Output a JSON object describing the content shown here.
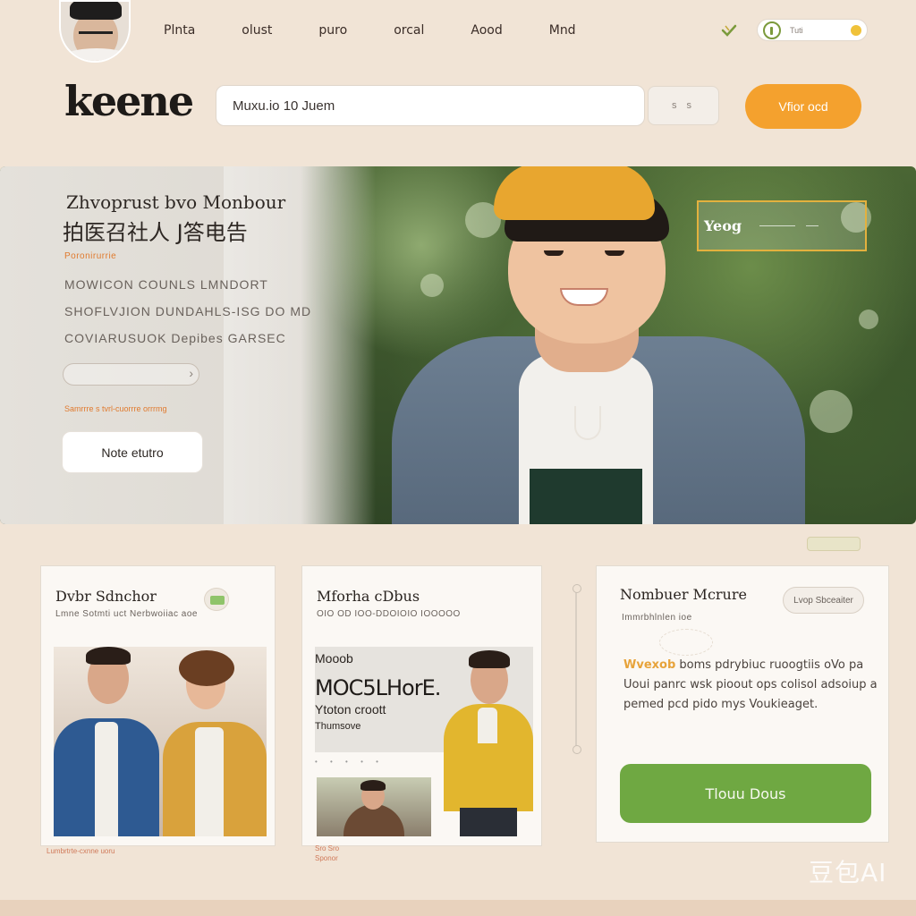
{
  "nav": {
    "links": [
      "Plnta",
      "olust",
      "puro",
      "orcal",
      "Aood",
      "Mnd"
    ],
    "pill_text": "Tuti"
  },
  "header": {
    "logo": "keene",
    "search_value": "Muxu.io 10 Juem",
    "filter_label": "s  s",
    "cta_label": "Vfior ocd"
  },
  "hero": {
    "title": "Zhvoprust bvo Monbour",
    "title_cn": "拍医召社人 J答电告",
    "kicker": "Poronirurrie",
    "lines": [
      "MOWICON COUNLS LMNDORT",
      "SHOFLVJION DUNDAHLS-ISG DO MD",
      "COVIARUSUOK Depibes GARSEC"
    ],
    "note": "Samrrre s tvrl-cuorrre orrrmg",
    "button_label": "Note  etutro",
    "tag_label": "Yeog"
  },
  "cards": {
    "card1": {
      "title": "Dvbr Sdnchor",
      "subtitle": "Lmne Sotmti uct Nerbwoiiac aoe",
      "caption": "Lumbrtrte-cxnne uoru"
    },
    "card2": {
      "title": "Mforha cDbus",
      "subtitle": "OIO OD IOO-DDOIOIO IOOOOO",
      "poster_small": "Mooob",
      "poster_big": "MOC5LHorE.",
      "poster_line1": "Ytoton croott",
      "poster_line2": "Thumsove",
      "poster_dots": "• • • • •",
      "caption_line1": "Sro Sro",
      "caption_line2": "Sponor"
    },
    "card3": {
      "title": "Nombuer Mcrure",
      "subtitle": "Immrbhlnlen ioe",
      "pill_label": "Lvop Sbceaiter",
      "body_accent": "Wvexob",
      "body_rest": " boms pdrybiuc ruoogtiis oVo pa Uoui panrc wsk pioout ops colisol adsoiup a pemed pcd pido mys Voukieaget.",
      "cta_label": "Tlouu Dous"
    }
  },
  "watermark": "豆包AI",
  "colors": {
    "background": "#f1e4d6",
    "accent_orange": "#f4a12e",
    "accent_green": "#6fa842",
    "accent_gold": "#e3b13e"
  }
}
